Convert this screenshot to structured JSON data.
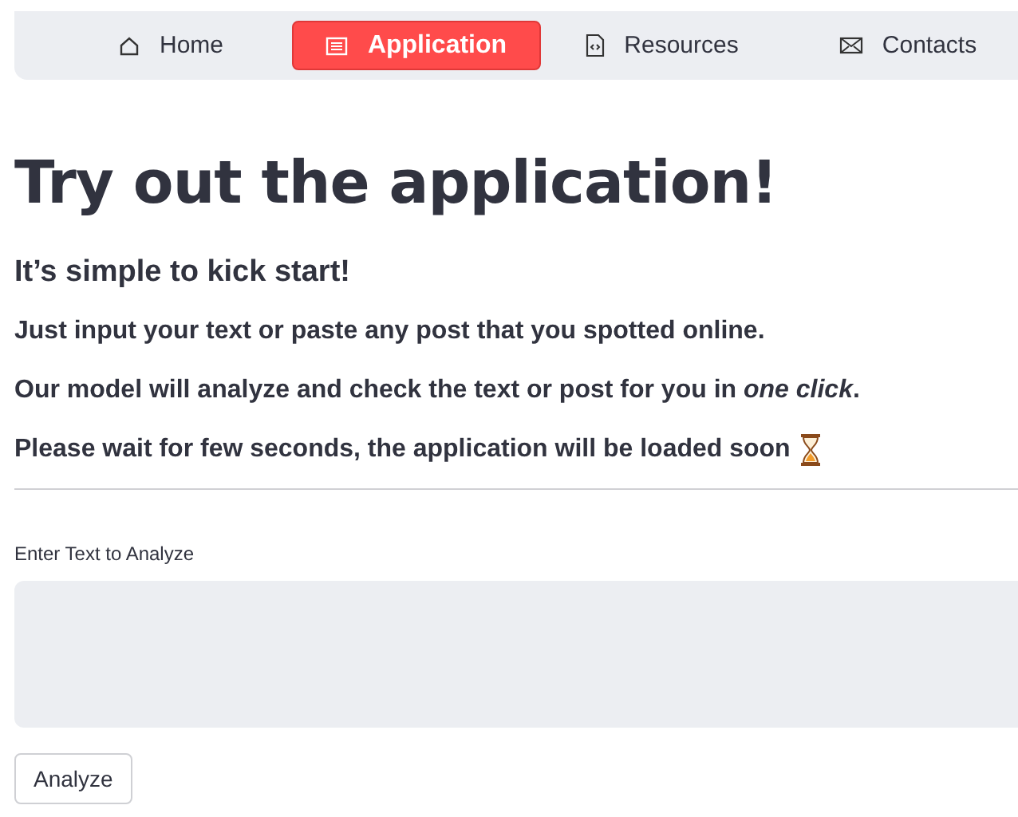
{
  "nav": [
    {
      "label": "Home",
      "selected": false
    },
    {
      "label": "Application",
      "selected": true
    },
    {
      "label": "Resources",
      "selected": false
    },
    {
      "label": "Contacts",
      "selected": false
    }
  ],
  "title": "Try out the application!",
  "subtitle": "It’s simple to kick start!",
  "paragraphs": [
    "Just input your text or paste any post that you spotted online.",
    "Our model will analyze and check the text or post for you in *one click*.",
    "Please wait for few seconds, the application will be loaded soon"
  ],
  "input": {
    "label": "Enter Text to Analyze"
  },
  "button": "Analyze"
}
